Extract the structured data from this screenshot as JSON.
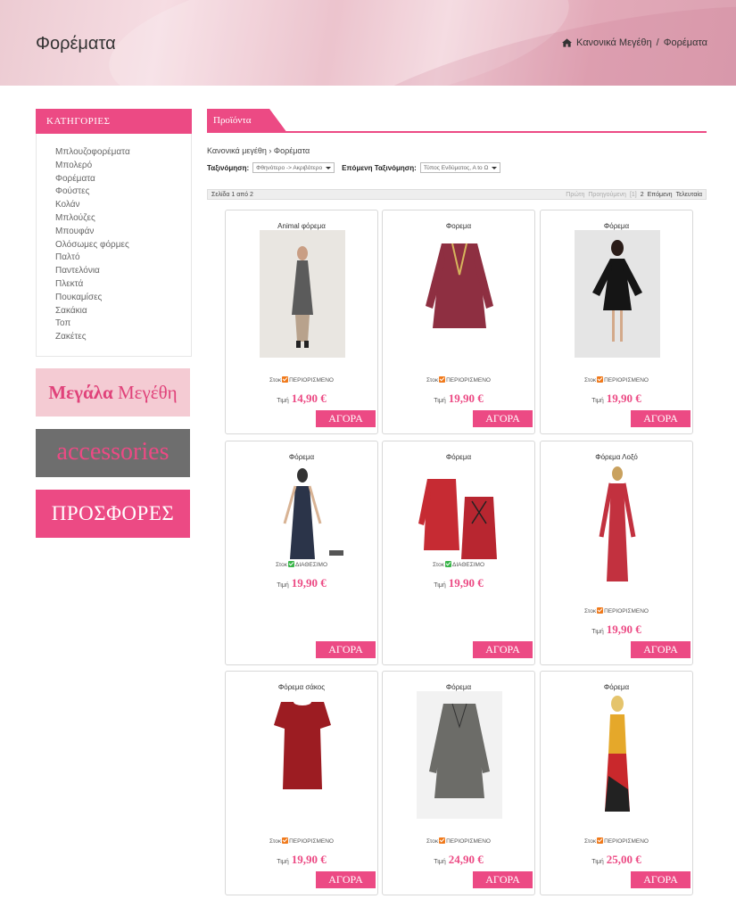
{
  "page": {
    "title": "Φορέματα"
  },
  "breadcrumb": {
    "home": "Κανονικά Μεγέθη",
    "sep": "/",
    "current": "Φορέματα"
  },
  "sidebar": {
    "header": "ΚΑΤΗΓΟΡΙΕΣ",
    "items": [
      "Μπλουζοφορέματα",
      "Μπολερό",
      "Φορέματα",
      "Φούστες",
      "Κολάν",
      "Μπλούζες",
      "Μπουφάν",
      "Ολόσωμες φόρμες",
      "Παλτό",
      "Παντελόνια",
      "Πλεκτά",
      "Πουκαμίσες",
      "Σακάκια",
      "Τοπ",
      "Ζακέτες"
    ]
  },
  "banners": {
    "big_bold": "Μεγάλα",
    "big_rest": "Μεγέθη",
    "accessories": "accessories",
    "offers": "ΠΡΟΣΦΟΡΕΣ"
  },
  "main": {
    "tab": "Προϊόντα",
    "crumb": "Κανονικά μεγέθη › Φορέματα",
    "sort_label": "Ταξινόμηση:",
    "sort_value": "Φθηνότερο -> Ακριβότερο",
    "next_sort_label": "Επόμενη Ταξινόμηση:",
    "next_sort_value": "Τύπος Ενδύματος, Α to Ω",
    "pager_left": "Σελίδα 1 από 2",
    "pager": {
      "first": "Πρώτη",
      "prev": "Προηγούμενη",
      "current": "[1]",
      "two": "2",
      "next": "Επόμενη",
      "last": "Τελευταία"
    }
  },
  "labels": {
    "stock": "Στοκ",
    "price": "Τιμή",
    "buy": "ΑΓΟΡΑ"
  },
  "products": [
    {
      "title": "Animal φόρεμα",
      "status": "ΠΕΡΙΟΡΙΣΜΕΝΟ",
      "status_color": "#f07a1c",
      "price": "14,90 €"
    },
    {
      "title": "Φορεμα",
      "status": "ΠΕΡΙΟΡΙΣΜΕΝΟ",
      "status_color": "#f07a1c",
      "price": "19,90 €"
    },
    {
      "title": "Φόρεμα",
      "status": "ΠΕΡΙΟΡΙΣΜΕΝΟ",
      "status_color": "#f07a1c",
      "price": "19,90 €"
    },
    {
      "title": "Φόρεμα",
      "status": "ΔΙΑΘΕΣΙΜΟ",
      "status_color": "#3ab54a",
      "price": "19,90 €"
    },
    {
      "title": "Φόρεμα",
      "status": "ΔΙΑΘΕΣΙΜΟ",
      "status_color": "#3ab54a",
      "price": "19,90 €"
    },
    {
      "title": "Φόρεμα Λοξό",
      "status": "ΠΕΡΙΟΡΙΣΜΕΝΟ",
      "status_color": "#f07a1c",
      "price": "19,90 €"
    },
    {
      "title": "Φόρεμα σάκος",
      "status": "ΠΕΡΙΟΡΙΣΜΕΝΟ",
      "status_color": "#f07a1c",
      "price": "19,90 €"
    },
    {
      "title": "Φόρεμα",
      "status": "ΠΕΡΙΟΡΙΣΜΕΝΟ",
      "status_color": "#f07a1c",
      "price": "24,90 €"
    },
    {
      "title": "Φόρεμα",
      "status": "ΠΕΡΙΟΡΙΣΜΕΝΟ",
      "status_color": "#f07a1c",
      "price": "25,00 €"
    }
  ]
}
